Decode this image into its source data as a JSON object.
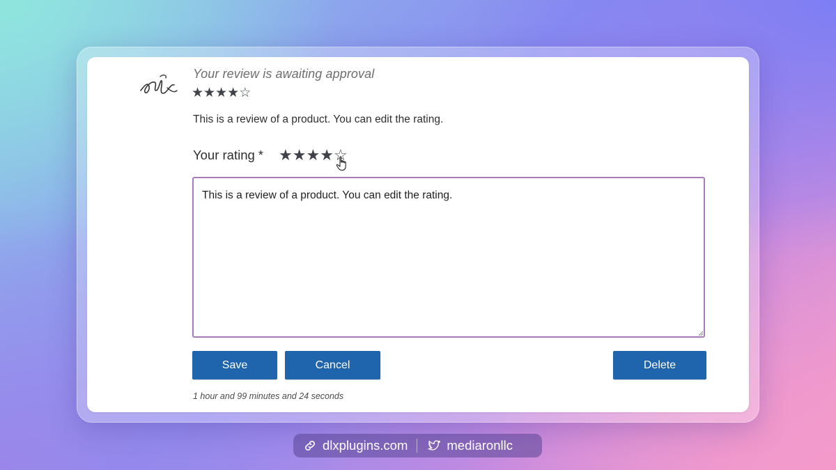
{
  "review": {
    "status_text": "Your review is awaiting approval",
    "rating": 4,
    "rating_max": 5,
    "body": "This is a review of a product. You can edit the rating."
  },
  "form": {
    "rating_label": "Your rating",
    "required_marker": "*",
    "selected_rating": 4,
    "textarea_value": "This is a review of a product. You can edit the rating.",
    "save_label": "Save",
    "cancel_label": "Cancel",
    "delete_label": "Delete"
  },
  "timestamp": "1 hour and 99 minutes and 24 seconds",
  "footer": {
    "website": "dlxplugins.com",
    "twitter": "mediaronllc"
  },
  "colors": {
    "button": "#1e65ad",
    "textarea_border": "#a77ab8",
    "star": "#3f4248"
  },
  "icons": {
    "avatar": "signature-avatar",
    "link": "link-icon",
    "twitter": "twitter-bird-icon",
    "cursor": "hand-pointer-icon"
  }
}
